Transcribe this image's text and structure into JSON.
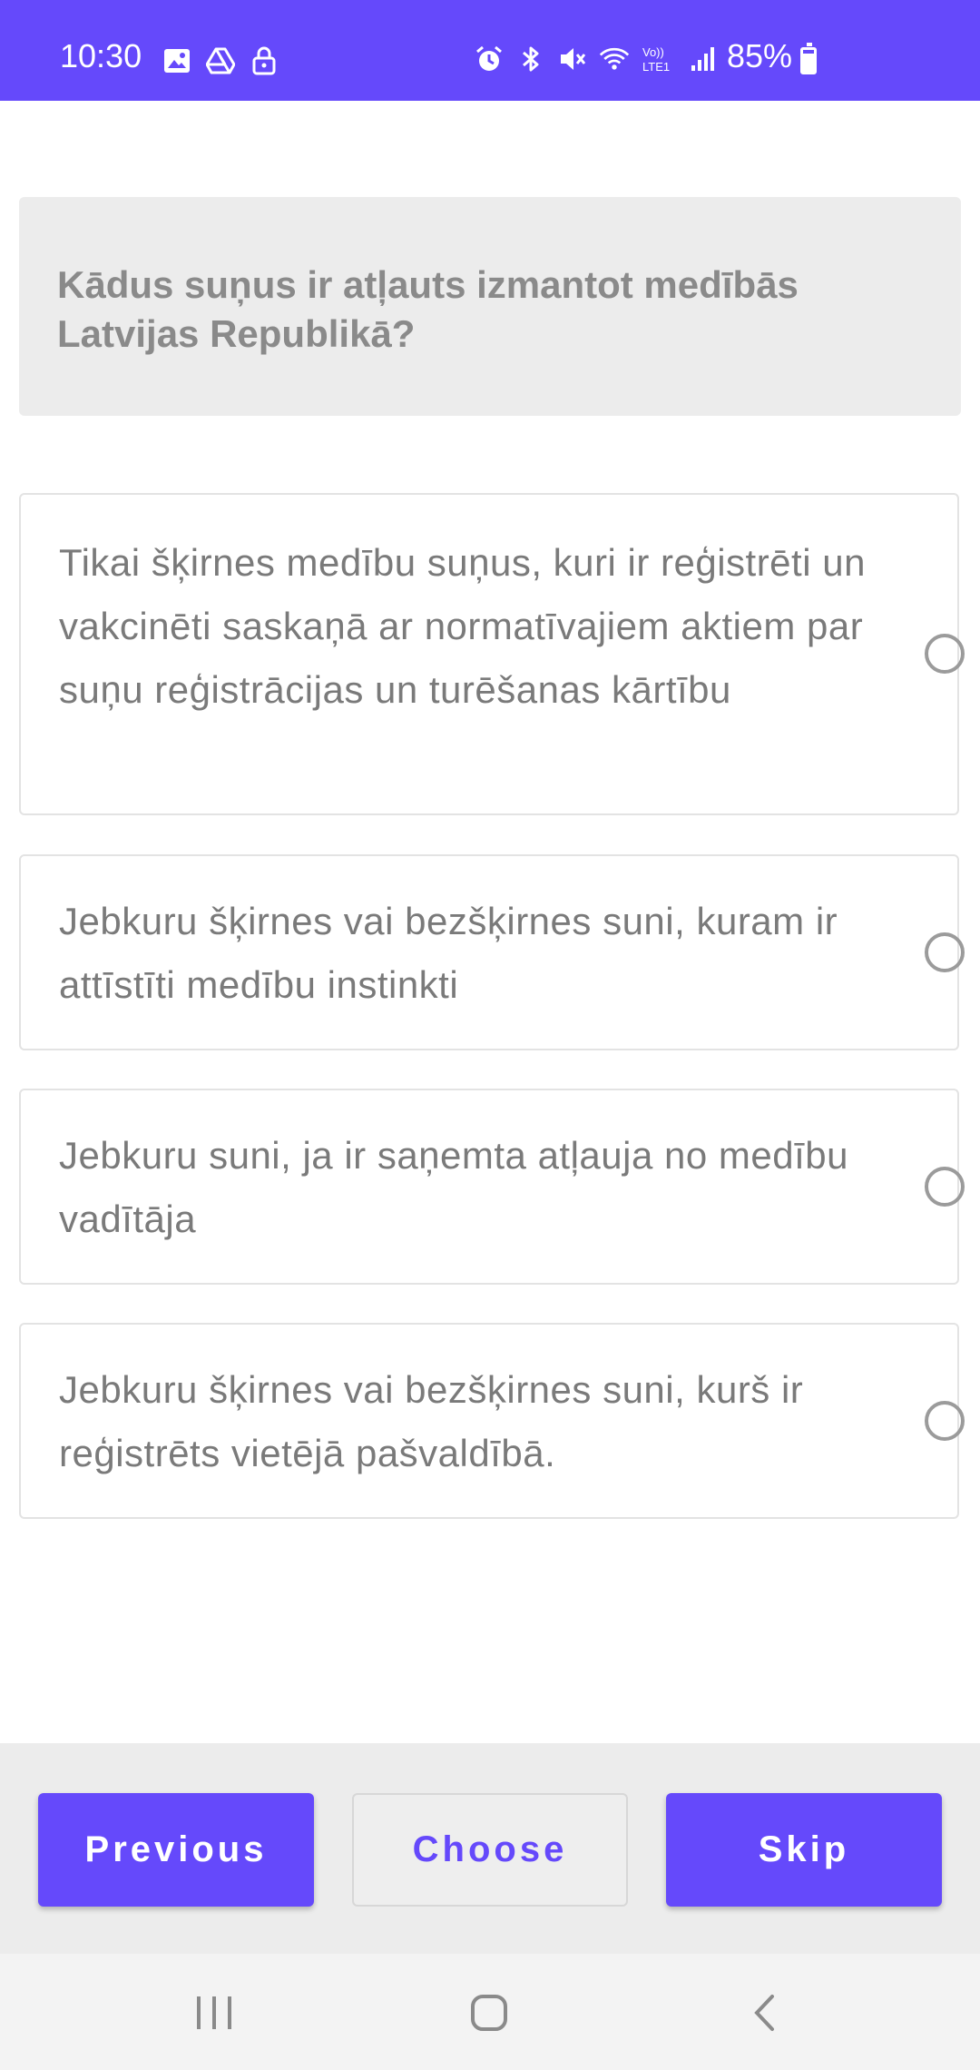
{
  "status_bar": {
    "time": "10:30",
    "battery": "85%",
    "battery_level": 0.85,
    "left_icons": [
      "image-icon",
      "drive-icon",
      "lock-icon"
    ],
    "right_icons": [
      "alarm-icon",
      "bluetooth-icon",
      "mute-icon",
      "wifi-icon",
      "volte-icon",
      "signal-icon",
      "battery-charging-icon"
    ],
    "volte_label": "Vo))\nLTE1"
  },
  "question": {
    "text": "Kādus suņus ir  atļauts izmantot  medībās Latvijas  Republikā?"
  },
  "options": [
    {
      "text": "Tikai šķirnes medību  suņus, kuri ir reģistrēti un vakcinēti  saskaņā ar normatīvajiem  aktiem par suņu reģistrācijas un  turēšanas kārtību",
      "selected": false
    },
    {
      "text": "Jebkuru šķirnes vai  bezšķirnes suni,  kuram ir attīstīti  medību instinkti",
      "selected": false
    },
    {
      "text": "Jebkuru suni, ja ir  saņemta atļauja no medību vadītāja",
      "selected": false
    },
    {
      "text": "Jebkuru šķirnes vai  bezšķirnes suni, kurš  ir reģistrēts vietējā  pašvaldībā.",
      "selected": false
    }
  ],
  "buttons": {
    "previous": "Previous",
    "choose": "Choose",
    "skip": "Skip"
  },
  "nav": {
    "icons": [
      "recent-apps-icon",
      "home-icon",
      "back-icon"
    ]
  },
  "colors": {
    "accent": "#6549fb",
    "question_bg": "#ececec",
    "bottom_bar_bg": "#ececec",
    "text_gray": "#7a7a7a"
  }
}
